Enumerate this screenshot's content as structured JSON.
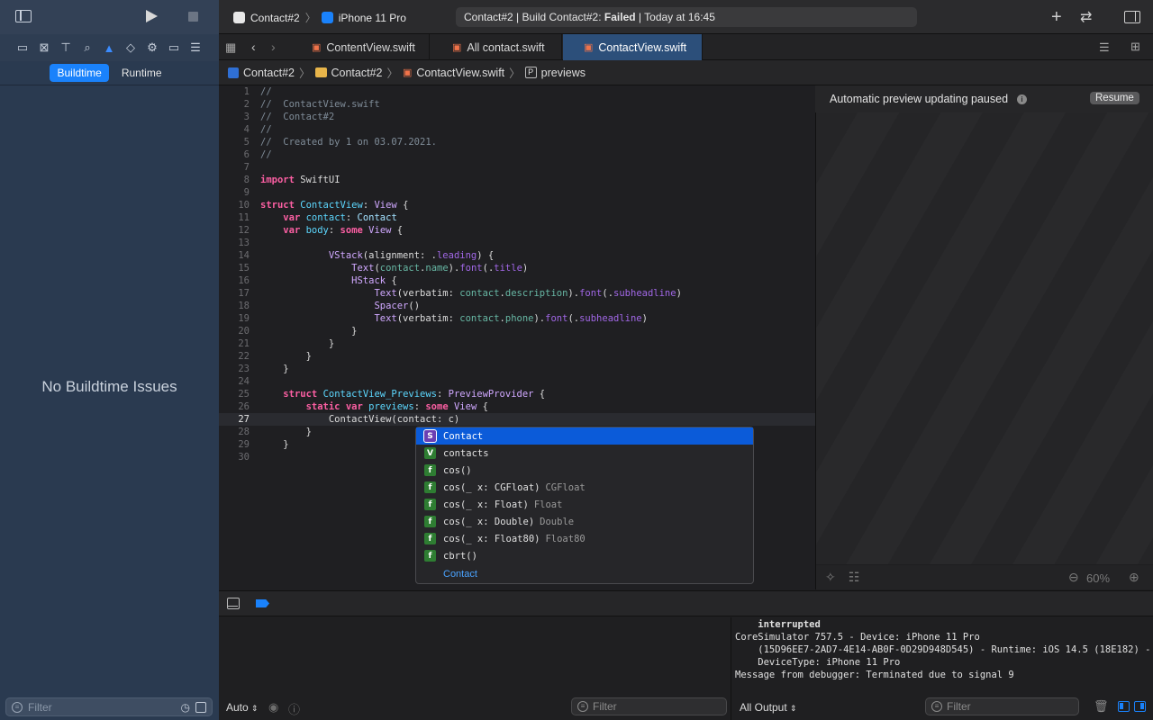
{
  "sidebar": {
    "segments": [
      "Buildtime",
      "Runtime"
    ],
    "empty_message": "No Buildtime Issues",
    "filter_placeholder": "Filter"
  },
  "toolbar": {
    "scheme_name": "Contact#2",
    "device_name": "iPhone 11 Pro",
    "activity_prefix": "Contact#2 | Build Contact#2: ",
    "activity_status": "Failed",
    "activity_suffix": " | Today at 16:45"
  },
  "tabs": [
    {
      "label": "ContentView.swift",
      "active": false
    },
    {
      "label": "All contact.swift",
      "active": false
    },
    {
      "label": "ContactView.swift",
      "active": true
    }
  ],
  "jumpbar": [
    "Contact#2",
    "Contact#2",
    "ContactView.swift",
    "previews"
  ],
  "editor": {
    "current_line": 27,
    "line_numbers": [
      "1",
      "2",
      "3",
      "4",
      "5",
      "6",
      "7",
      "8",
      "9",
      "10",
      "11",
      "12",
      "13",
      "14",
      "15",
      "16",
      "17",
      "18",
      "19",
      "20",
      "21",
      "22",
      "23",
      "24",
      "25",
      "26",
      "27",
      "28",
      "29",
      "30"
    ]
  },
  "autocomplete": {
    "items": [
      {
        "badge": "S",
        "kind": "struct",
        "text": "Contact",
        "ret": "",
        "selected": true
      },
      {
        "badge": "V",
        "kind": "var",
        "text": "contacts",
        "ret": "",
        "selected": false
      },
      {
        "badge": "f",
        "kind": "func",
        "text": "cos()",
        "ret": "",
        "selected": false
      },
      {
        "badge": "f",
        "kind": "func",
        "text": "cos(_ x: CGFloat)",
        "ret": "CGFloat",
        "selected": false
      },
      {
        "badge": "f",
        "kind": "func",
        "text": "cos(_ x: Float)",
        "ret": "Float",
        "selected": false
      },
      {
        "badge": "f",
        "kind": "func",
        "text": "cos(_ x: Double)",
        "ret": "Double",
        "selected": false
      },
      {
        "badge": "f",
        "kind": "func",
        "text": "cos(_ x: Float80)",
        "ret": "Float80",
        "selected": false
      },
      {
        "badge": "f",
        "kind": "func",
        "text": "cbrt()",
        "ret": "",
        "selected": false
      }
    ],
    "footer": "Contact"
  },
  "preview": {
    "status": "Automatic preview updating paused",
    "resume_label": "Resume",
    "zoom": "60%"
  },
  "debug": {
    "auto_label": "Auto",
    "vars_filter_placeholder": "Filter",
    "output_selector": "All Output",
    "console_filter_placeholder": "Filter",
    "console_lines": [
      "    interrupted",
      "CoreSimulator 757.5 - Device: iPhone 11 Pro",
      "    (15D96EE7-2AD7-4E14-AB0F-0D29D948D545) - Runtime: iOS 14.5 (18E182) -",
      "    DeviceType: iPhone 11 Pro",
      "Message from debugger: Terminated due to signal 9"
    ]
  },
  "colors": {
    "accent": "#1a82fb",
    "sidebar_bg": "#2a3a50",
    "editor_bg": "#1f1f22",
    "keyword": "#fc5fa3",
    "selection": "#0b5bd9"
  }
}
